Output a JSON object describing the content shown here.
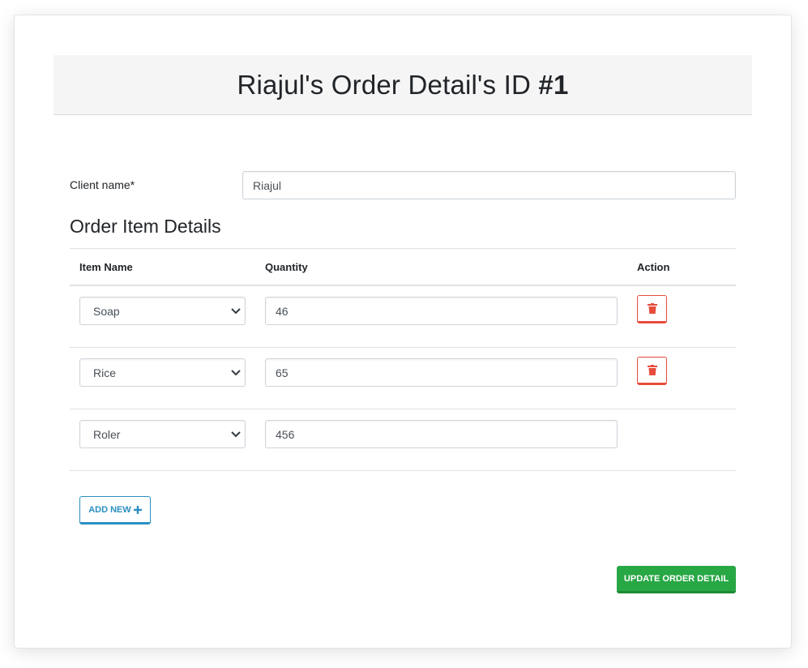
{
  "header": {
    "title_prefix": "Riajul's Order Detail's ID ",
    "title_id": "#1"
  },
  "client": {
    "label": "Client name*",
    "value": "Riajul"
  },
  "items_section": {
    "title": "Order Item Details",
    "columns": [
      "Item Name",
      "Quantity",
      "Action"
    ],
    "rows": [
      {
        "item": "Soap",
        "quantity": "46",
        "deletable": true
      },
      {
        "item": "Rice",
        "quantity": "65",
        "deletable": true
      },
      {
        "item": "Roler",
        "quantity": "456",
        "deletable": false
      }
    ]
  },
  "actions": {
    "add_new_label": "ADD NEW",
    "update_label": "UPDATE ORDER DETAIL"
  },
  "icons": {
    "delete": "trash-icon",
    "add": "plus-icon",
    "select": "chevron-down-icon"
  },
  "colors": {
    "danger": "#e74c3c",
    "info": "#2b8fc2",
    "success": "#28a745"
  }
}
